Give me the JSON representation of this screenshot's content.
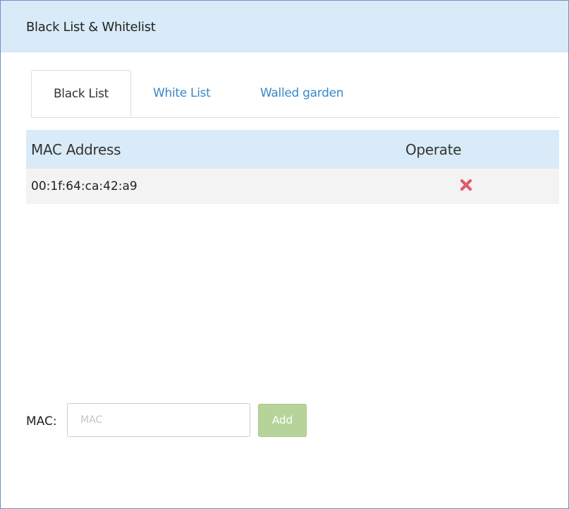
{
  "header": {
    "title": "Black List & Whitelist"
  },
  "tabs": [
    {
      "label": "Black List",
      "active": true
    },
    {
      "label": "White List",
      "active": false
    },
    {
      "label": "Walled garden",
      "active": false
    }
  ],
  "table": {
    "columns": [
      "MAC Address",
      "Operate"
    ],
    "rows": [
      {
        "mac": "00:1f:64:ca:42:a9",
        "operate_icon": "delete-x-icon"
      }
    ]
  },
  "form": {
    "label": "MAC:",
    "placeholder": "MAC",
    "value": "",
    "add_label": "Add"
  },
  "colors": {
    "header_bg": "#d9ebf8",
    "link": "#3a88c7",
    "delete": "#e25b6a",
    "add_button": "#b6d49a"
  }
}
